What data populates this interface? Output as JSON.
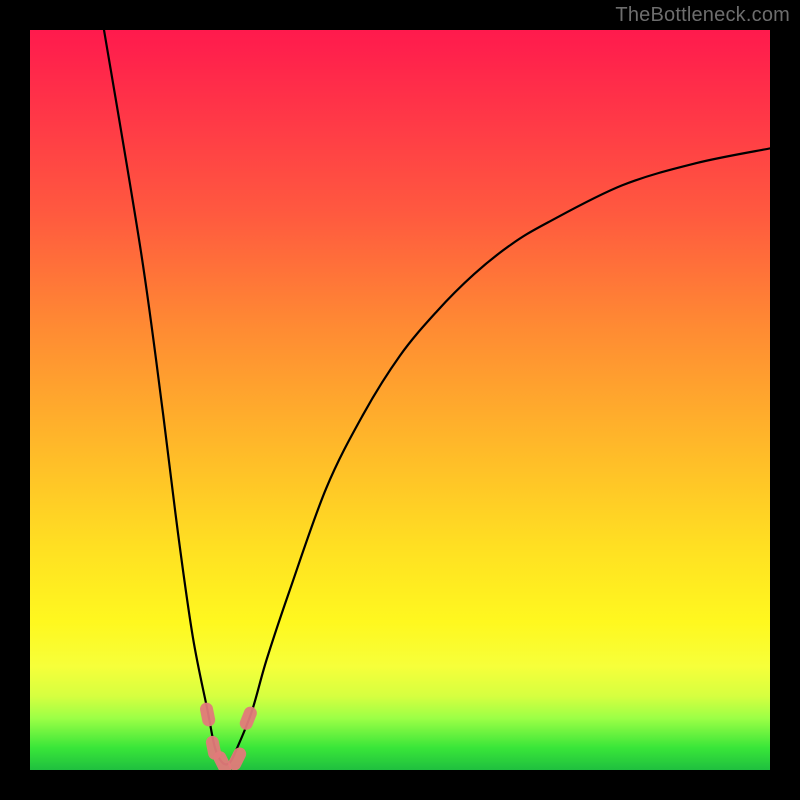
{
  "watermark": {
    "text": "TheBottleneck.com"
  },
  "chart_data": {
    "type": "line",
    "title": "",
    "xlabel": "",
    "ylabel": "",
    "xlim": [
      0,
      100
    ],
    "ylim": [
      0,
      100
    ],
    "grid": false,
    "legend": false,
    "series": [
      {
        "name": "bottleneck-curve",
        "x": [
          10,
          15,
          18,
          20,
          22,
          24,
          25,
          26,
          27,
          28,
          30,
          32,
          35,
          40,
          45,
          50,
          55,
          60,
          65,
          70,
          80,
          90,
          100
        ],
        "y": [
          100,
          70,
          48,
          32,
          18,
          8,
          3,
          1,
          1,
          3,
          8,
          15,
          24,
          38,
          48,
          56,
          62,
          67,
          71,
          74,
          79,
          82,
          84
        ]
      }
    ],
    "markers": [
      {
        "name": "marker-left-upper",
        "x": 24.0,
        "y": 7.5
      },
      {
        "name": "marker-left-lower",
        "x": 24.8,
        "y": 3.0
      },
      {
        "name": "marker-floor-left",
        "x": 26.0,
        "y": 1.0
      },
      {
        "name": "marker-floor-right",
        "x": 28.0,
        "y": 1.5
      },
      {
        "name": "marker-right-upper",
        "x": 29.5,
        "y": 7.0
      }
    ],
    "marker_style": {
      "shape": "rounded-capsule",
      "color": "#e17a7a",
      "size": 14
    },
    "gradient_stops": [
      {
        "pos": 0.0,
        "color": "#ff1a4d"
      },
      {
        "pos": 0.25,
        "color": "#ff5a3f"
      },
      {
        "pos": 0.55,
        "color": "#ffb52a"
      },
      {
        "pos": 0.8,
        "color": "#fff81f"
      },
      {
        "pos": 0.9,
        "color": "#d6ff40"
      },
      {
        "pos": 1.0,
        "color": "#1fbf3f"
      }
    ]
  }
}
